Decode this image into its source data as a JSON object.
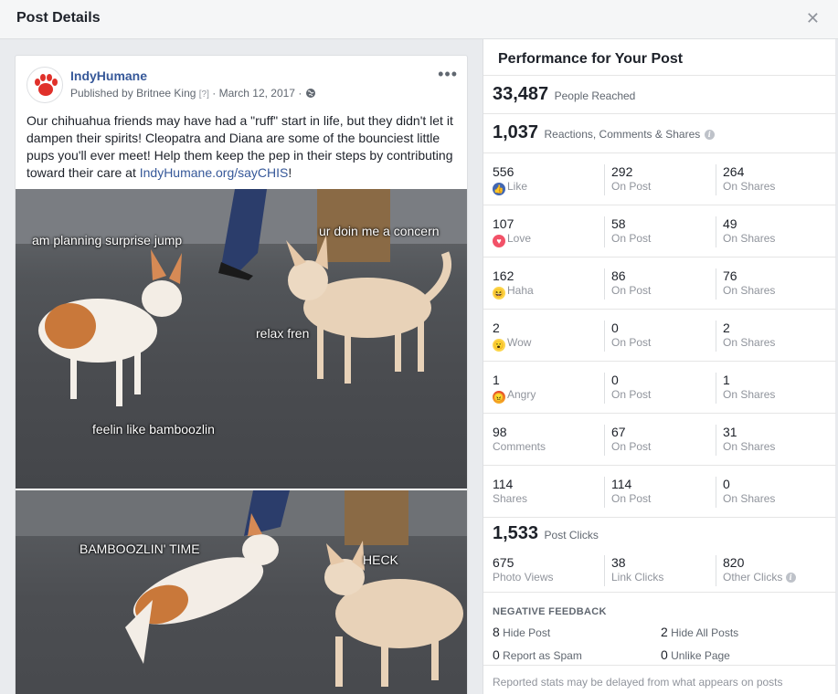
{
  "dialog": {
    "title": "Post Details",
    "close_icon": "close-icon"
  },
  "post": {
    "page_name": "IndyHumane",
    "published_by_prefix": "Published by",
    "author": "Britnee King",
    "help": "[?]",
    "date": "March 12, 2017",
    "separator": "·",
    "more": "•••",
    "text": "Our chihuahua friends may have had a \"ruff\" start in life, but they didn't let it dampen their spirits! Cleopatra and Diana are some of the bounciest little pups you'll ever meet! Help them keep the pep in their steps by contributing toward their care at ",
    "link": "IndyHumane.org/sayCHIS",
    "text_end": "!",
    "photo1_captions": [
      "am planning surprise jump",
      "ur doin me a concern",
      "relax fren",
      "feelin like bamboozlin"
    ],
    "photo2_captions": [
      "BAMBOOZLIN' TIME",
      "HECK"
    ],
    "brand_color": "#e0302a"
  },
  "performance": {
    "title": "Performance for Your Post",
    "reach": {
      "value": "33,487",
      "label": "People Reached"
    },
    "engagement": {
      "value": "1,037",
      "label": "Reactions, Comments & Shares"
    },
    "rows": [
      {
        "icon": "like-icon",
        "total": "556",
        "label": "Like",
        "on_post": "292",
        "on_shares": "264"
      },
      {
        "icon": "love-icon",
        "total": "107",
        "label": "Love",
        "on_post": "58",
        "on_shares": "49"
      },
      {
        "icon": "haha-icon",
        "total": "162",
        "label": "Haha",
        "on_post": "86",
        "on_shares": "76"
      },
      {
        "icon": "wow-icon",
        "total": "2",
        "label": "Wow",
        "on_post": "0",
        "on_shares": "2"
      },
      {
        "icon": "angry-icon",
        "total": "1",
        "label": "Angry",
        "on_post": "0",
        "on_shares": "1"
      },
      {
        "icon": "",
        "total": "98",
        "label": "Comments",
        "on_post": "67",
        "on_shares": "31"
      },
      {
        "icon": "",
        "total": "114",
        "label": "Shares",
        "on_post": "114",
        "on_shares": "0"
      }
    ],
    "on_post_label": "On Post",
    "on_shares_label": "On Shares",
    "clicks": {
      "value": "1,533",
      "label": "Post Clicks"
    },
    "click_breakdown": [
      {
        "value": "675",
        "label": "Photo Views"
      },
      {
        "value": "38",
        "label": "Link Clicks"
      },
      {
        "value": "820",
        "label": "Other Clicks"
      }
    ],
    "negative": {
      "title": "NEGATIVE FEEDBACK",
      "items": [
        {
          "value": "8",
          "label": "Hide Post"
        },
        {
          "value": "2",
          "label": "Hide All Posts"
        },
        {
          "value": "0",
          "label": "Report as Spam"
        },
        {
          "value": "0",
          "label": "Unlike Page"
        }
      ]
    },
    "footer": "Reported stats may be delayed from what appears on posts"
  }
}
